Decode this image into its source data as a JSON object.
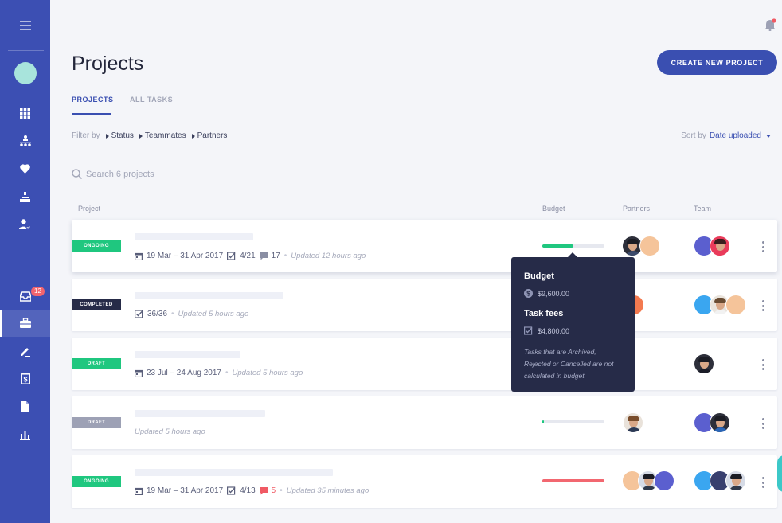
{
  "colors": {
    "sidebar": "#3c4fb3",
    "accent": "#3a4fb1",
    "ongoing": "#1fc77f",
    "completed": "#262b48",
    "draft_green": "#1fc77f",
    "draft_gray": "#9da1b5",
    "budget_good": "#1fc77f",
    "budget_over": "#f26770",
    "tooltip_bg": "#262b48"
  },
  "sidebar": {
    "menu_icon": "hamburger-icon",
    "nav_items": [
      {
        "icon": "grid-icon"
      },
      {
        "icon": "org-chart-icon"
      },
      {
        "icon": "heart-icon"
      },
      {
        "icon": "hierarchy-icon"
      },
      {
        "icon": "user-check-icon"
      },
      {
        "icon": "inbox-icon",
        "badge": "12"
      },
      {
        "icon": "briefcase-icon",
        "active": true
      },
      {
        "icon": "pen-icon"
      },
      {
        "icon": "invoice-icon"
      },
      {
        "icon": "document-icon"
      },
      {
        "icon": "bar-chart-icon"
      }
    ]
  },
  "header": {
    "title": "Projects",
    "create_button": "CREATE NEW PROJECT",
    "notification_icon": "bell-icon"
  },
  "tabs": [
    {
      "label": "PROJECTS",
      "active": true
    },
    {
      "label": "ALL TASKS",
      "active": false
    }
  ],
  "filters": {
    "label": "Filter by",
    "items": [
      "Status",
      "Teammates",
      "Partners"
    ]
  },
  "sort": {
    "label": "Sort by",
    "value": "Date uploaded"
  },
  "search": {
    "placeholder": "Search 6 projects"
  },
  "columns": {
    "project": "Project",
    "budget": "Budget",
    "partners": "Partners",
    "team": "Team"
  },
  "projects": [
    {
      "status": "ONGOING",
      "dates": "19 Mar – 31 Apr 2017",
      "tasks": "4/21",
      "comments": "17",
      "updated": "Updated 12 hours ago",
      "budget_fraction": 0.5
    },
    {
      "status": "COMPLETED",
      "tasks": "36/36",
      "updated": "Updated 5 hours ago"
    },
    {
      "status": "DRAFT",
      "dates": "23 Jul – 24 Aug 2017",
      "updated": "Updated 5 hours ago"
    },
    {
      "status": "DRAFT",
      "updated": "Updated 5 hours ago",
      "budget_fraction": 0.03
    },
    {
      "status": "ONGOING",
      "dates": "19 Mar – 31 Apr 2017",
      "tasks": "4/13",
      "comments": "5",
      "updated": "Updated 35 minutes ago",
      "budget_fraction": 1.0
    }
  ],
  "tooltip": {
    "budget_label": "Budget",
    "budget_value": "$9,600.00",
    "fees_label": "Task fees",
    "fees_value": "$4,800.00",
    "note": "Tasks that are Archived, Rejected or Cancelled are not calculated in budget"
  }
}
